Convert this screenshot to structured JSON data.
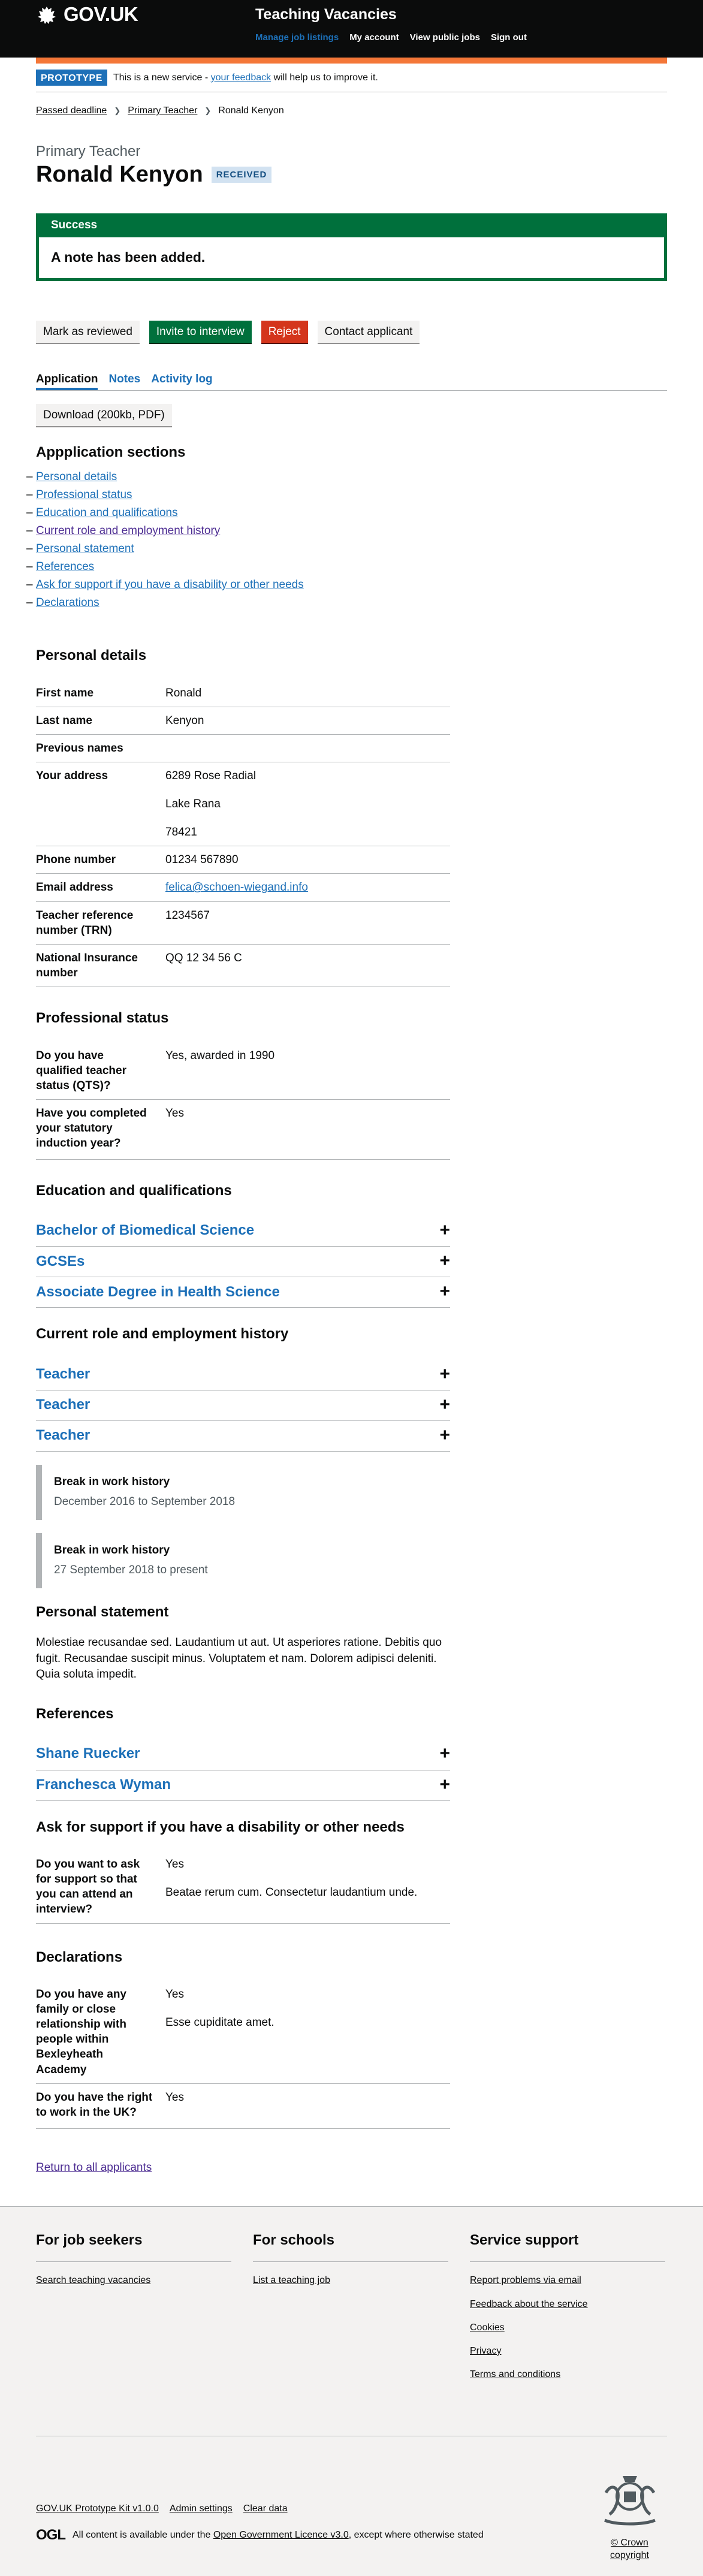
{
  "header": {
    "logo_text": "GOV.UK",
    "service_name": "Teaching Vacancies",
    "nav": [
      "Manage job listings",
      "My account",
      "View public jobs",
      "Sign out"
    ]
  },
  "phase": {
    "tag": "PROTOTYPE",
    "text_before": "This is a new service - ",
    "link": "your feedback",
    "text_after": " will help us to improve it."
  },
  "breadcrumb": [
    "Passed deadline",
    "Primary Teacher",
    "Ronald Kenyon"
  ],
  "caption": "Primary Teacher",
  "title": "Ronald Kenyon",
  "status_tag": "Received",
  "banner": {
    "title": "Success",
    "message": "A note has been added."
  },
  "actions": {
    "mark_reviewed": "Mark as reviewed",
    "invite": "Invite to interview",
    "reject": "Reject",
    "contact": "Contact applicant"
  },
  "tabs": [
    "Application",
    "Notes",
    "Activity log"
  ],
  "download": "Download (200kb, PDF)",
  "sections_heading": "Appplication sections",
  "sections": [
    "Personal details",
    "Professional status",
    "Education and qualifications",
    "Current role and employment history",
    "Personal statement",
    "References",
    "Ask for support if you have a disability or other needs",
    "Declarations"
  ],
  "personal": {
    "heading": "Personal details",
    "first_name_label": "First name",
    "first_name": "Ronald",
    "last_name_label": "Last name",
    "last_name": "Kenyon",
    "previous_names_label": "Previous names",
    "address_label": "Your address",
    "address": [
      "6289 Rose Radial",
      "Lake Rana",
      "78421"
    ],
    "phone_label": "Phone number",
    "phone": "01234 567890",
    "email_label": "Email address",
    "email": "felica@schoen-wiegand.info",
    "trn_label": "Teacher reference number (TRN)",
    "trn": "1234567",
    "ni_label": "National Insurance number",
    "ni": "QQ 12 34 56 C"
  },
  "professional": {
    "heading": "Professional status",
    "qts_label": "Do you have qualified teacher status (QTS)?",
    "qts": "Yes, awarded in 1990",
    "induction_label": "Have you completed your statutory induction year?",
    "induction": "Yes"
  },
  "education": {
    "heading": "Education and qualifications",
    "items": [
      "Bachelor of Biomedical Science",
      "GCSEs",
      "Associate Degree in Health Science"
    ]
  },
  "employment": {
    "heading": "Current role and employment history",
    "items": [
      "Teacher",
      "Teacher",
      "Teacher"
    ],
    "breaks": [
      {
        "title": "Break in work history",
        "dates": "December 2016 to September 2018"
      },
      {
        "title": "Break in work history",
        "dates": "27 September 2018 to present"
      }
    ]
  },
  "statement": {
    "heading": "Personal statement",
    "text": "Molestiae recusandae sed. Laudantium ut aut. Ut asperiores ratione. Debitis quo fugit. Recusandae suscipit minus. Voluptatem et nam. Dolorem adipisci deleniti. Quia soluta impedit."
  },
  "references": {
    "heading": "References",
    "items": [
      "Shane Ruecker",
      "Franchesca Wyman"
    ]
  },
  "support": {
    "heading": "Ask for support if you have a disability or other needs",
    "question": "Do you want to ask for support so that you can attend an interview?",
    "answer": "Yes",
    "detail": "Beatae rerum cum. Consectetur laudantium unde."
  },
  "declarations": {
    "heading": "Declarations",
    "q1": "Do you have any family or close relationship with people within Bexleyheath Academy",
    "a1": "Yes",
    "a1_detail": "Esse cupiditate amet.",
    "q2": "Do you have the right to work in the UK?",
    "a2": "Yes"
  },
  "return_link": "Return to all applicants",
  "footer": {
    "job_seekers_heading": "For job seekers",
    "job_seekers_links": [
      "Search teaching vacancies"
    ],
    "schools_heading": "For schools",
    "schools_links": [
      "List a teaching job"
    ],
    "support_heading": "Service support",
    "support_links": [
      "Report problems via email",
      "Feedback about the service",
      "Cookies",
      "Privacy",
      "Terms and conditions"
    ],
    "meta_links": [
      "GOV.UK Prototype Kit v1.0.0",
      "Admin settings",
      "Clear data"
    ],
    "ogl": "OGL",
    "licence_before": "All content is available under the ",
    "licence_link": "Open Government Licence v3.0",
    "licence_after": ", except where otherwise stated",
    "crown": "© Crown copyright"
  }
}
